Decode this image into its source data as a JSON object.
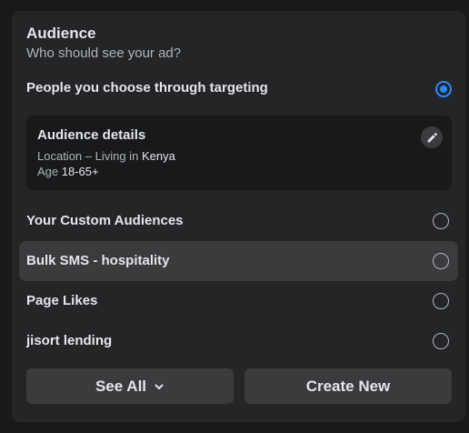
{
  "section": {
    "title": "Audience",
    "subtitle": "Who should see your ad?"
  },
  "targeting_option": {
    "label": "People you choose through targeting",
    "selected": true
  },
  "audience_details": {
    "title": "Audience details",
    "location_label": "Location – Living in",
    "location_value": "Kenya",
    "age_label": "Age",
    "age_value": "18-65+",
    "edit_icon": "pencil-icon"
  },
  "audiences": [
    {
      "label": "Your Custom Audiences",
      "selected": false,
      "highlighted": false
    },
    {
      "label": "Bulk SMS - hospitality",
      "selected": false,
      "highlighted": true
    },
    {
      "label": "Page Likes",
      "selected": false,
      "highlighted": false
    },
    {
      "label": "jisort lending",
      "selected": false,
      "highlighted": false
    }
  ],
  "buttons": {
    "see_all": "See All",
    "create_new": "Create New"
  },
  "colors": {
    "background": "#18191a",
    "panel": "#242526",
    "accent": "#2d88ff",
    "button": "#3a3b3c"
  }
}
